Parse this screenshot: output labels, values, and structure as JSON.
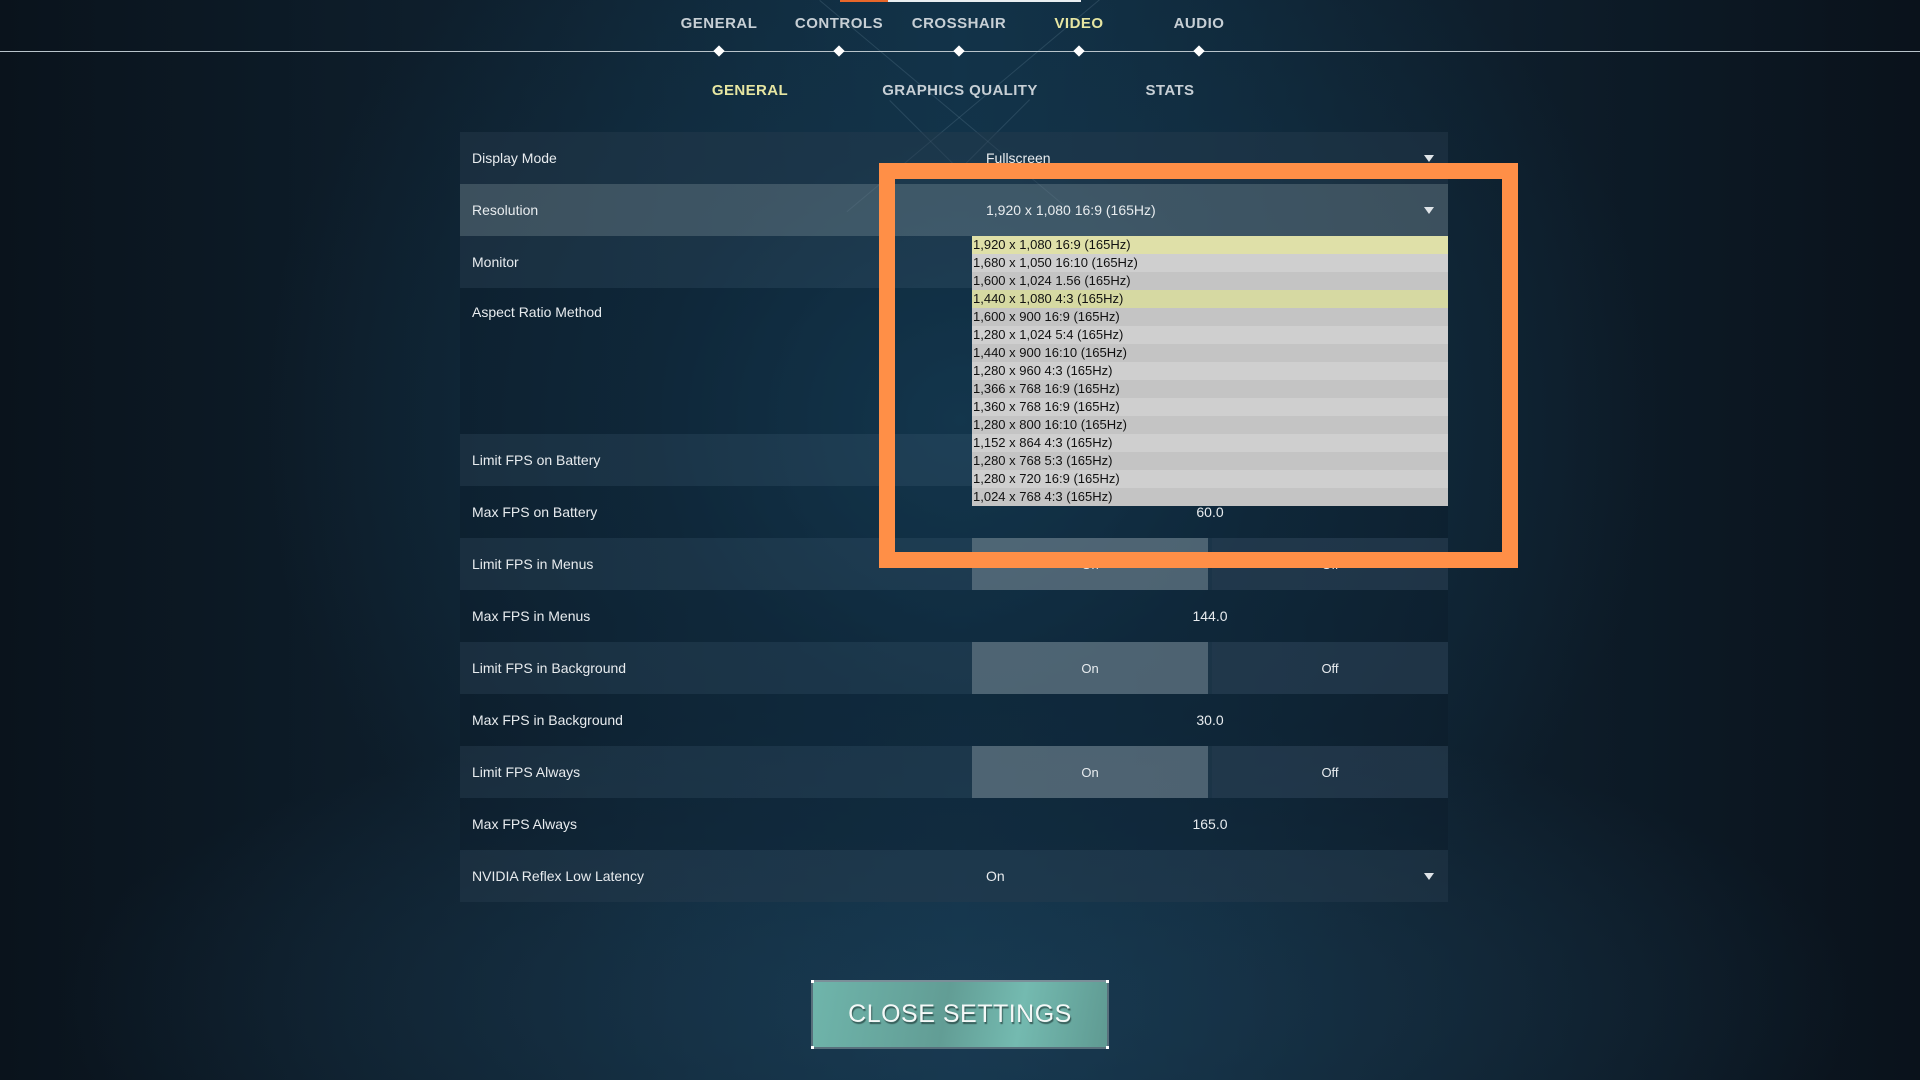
{
  "top_nav": {
    "items": [
      {
        "label": "GENERAL",
        "active": false
      },
      {
        "label": "CONTROLS",
        "active": false
      },
      {
        "label": "CROSSHAIR",
        "active": false
      },
      {
        "label": "VIDEO",
        "active": true
      },
      {
        "label": "AUDIO",
        "active": false
      }
    ]
  },
  "sub_nav": {
    "items": [
      {
        "label": "GENERAL",
        "active": true
      },
      {
        "label": "GRAPHICS QUALITY",
        "active": false
      },
      {
        "label": "STATS",
        "active": false
      }
    ]
  },
  "settings": {
    "display_mode": {
      "label": "Display Mode",
      "value": "Fullscreen"
    },
    "resolution": {
      "label": "Resolution",
      "value": "1,920 x 1,080 16:9 (165Hz)"
    },
    "monitor": {
      "label": "Monitor"
    },
    "aspect_ratio_method": {
      "label": "Aspect Ratio Method"
    },
    "limit_fps_battery": {
      "label": "Limit FPS on Battery"
    },
    "max_fps_battery": {
      "label": "Max FPS on Battery",
      "value": "60.0"
    },
    "limit_fps_menus": {
      "label": "Limit FPS in Menus",
      "on": "On",
      "off": "Off",
      "selected": "On"
    },
    "max_fps_menus": {
      "label": "Max FPS in Menus",
      "value": "144.0"
    },
    "limit_fps_background": {
      "label": "Limit FPS in Background",
      "on": "On",
      "off": "Off",
      "selected": "On"
    },
    "max_fps_background": {
      "label": "Max FPS in Background",
      "value": "30.0"
    },
    "limit_fps_always": {
      "label": "Limit FPS Always",
      "on": "On",
      "off": "Off",
      "selected": "On"
    },
    "max_fps_always": {
      "label": "Max FPS Always",
      "value": "165.0"
    },
    "nvidia_reflex": {
      "label": "NVIDIA Reflex Low Latency",
      "value": "On"
    }
  },
  "resolution_options": [
    "1,920 x 1,080 16:9 (165Hz)",
    "1,680 x 1,050 16:10 (165Hz)",
    "1,600 x 1,024 1.56 (165Hz)",
    "1,440 x 1,080 4:3 (165Hz)",
    "1,600 x 900 16:9 (165Hz)",
    "1,280 x 1,024 5:4 (165Hz)",
    "1,440 x 900 16:10 (165Hz)",
    "1,280 x 960 4:3 (165Hz)",
    "1,366 x 768 16:9 (165Hz)",
    "1,360 x 768 16:9 (165Hz)",
    "1,280 x 800 16:10 (165Hz)",
    "1,152 x 864 4:3 (165Hz)",
    "1,280 x 768 5:3 (165Hz)",
    "1,280 x 720 16:9 (165Hz)",
    "1,024 x 768 4:3 (165Hz)"
  ],
  "resolution_current_index": 0,
  "resolution_hover_index": 3,
  "close_button": {
    "label": "CLOSE SETTINGS"
  },
  "colors": {
    "active_tab": "#e7e6a2",
    "annotation": "#ff8f47",
    "accent_orange": "#e8672a",
    "close_button": "#6fb5ab"
  }
}
